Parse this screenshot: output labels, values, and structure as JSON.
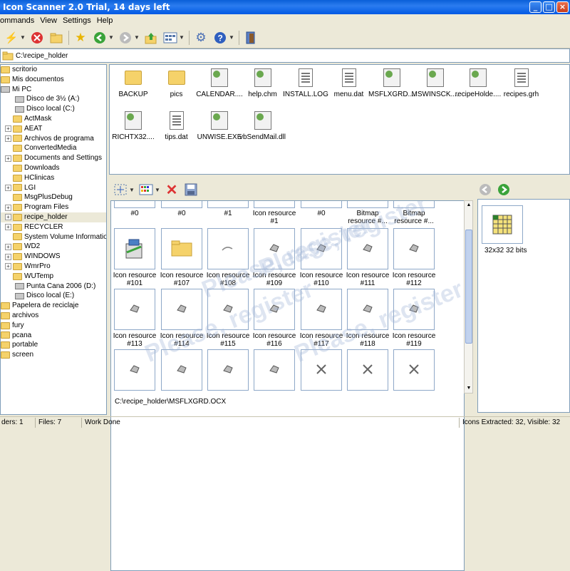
{
  "window": {
    "title": "Icon Scanner 2.0 Trial, 14 days left"
  },
  "menu": [
    "ommands",
    "View",
    "Settings",
    "Help"
  ],
  "address": {
    "path": "C:\\recipe_holder"
  },
  "tree": [
    {
      "label": "scritorio",
      "level": 0,
      "icon": "desktop-icon",
      "plus": false
    },
    {
      "label": "Mis documentos",
      "level": 0,
      "icon": "documents-icon",
      "plus": false
    },
    {
      "label": "Mi PC",
      "level": 0,
      "icon": "computer-icon",
      "plus": false
    },
    {
      "label": "Disco de 3½ (A:)",
      "level": 1,
      "icon": "floppy-icon",
      "plus": false
    },
    {
      "label": "Disco local (C:)",
      "level": 1,
      "icon": "drive-icon",
      "plus": false
    },
    {
      "label": "ActMask",
      "level": 2,
      "icon": "folder-icon",
      "plus": false
    },
    {
      "label": "AEAT",
      "level": 2,
      "icon": "folder-icon",
      "plus": true
    },
    {
      "label": "Archivos de programa",
      "level": 2,
      "icon": "folder-icon",
      "plus": true
    },
    {
      "label": "ConvertedMedia",
      "level": 2,
      "icon": "folder-icon",
      "plus": false
    },
    {
      "label": "Documents and Settings",
      "level": 2,
      "icon": "folder-icon",
      "plus": true
    },
    {
      "label": "Downloads",
      "level": 2,
      "icon": "folder-icon",
      "plus": false
    },
    {
      "label": "HClinicas",
      "level": 2,
      "icon": "folder-icon",
      "plus": false
    },
    {
      "label": "LGI",
      "level": 2,
      "icon": "folder-icon",
      "plus": true
    },
    {
      "label": "MsgPlusDebug",
      "level": 2,
      "icon": "folder-icon",
      "plus": false
    },
    {
      "label": "Program Files",
      "level": 2,
      "icon": "folder-icon",
      "plus": true
    },
    {
      "label": "recipe_holder",
      "level": 2,
      "icon": "folder-icon",
      "plus": true,
      "selected": true
    },
    {
      "label": "RECYCLER",
      "level": 2,
      "icon": "folder-icon",
      "plus": true
    },
    {
      "label": "System Volume Information",
      "level": 2,
      "icon": "folder-icon",
      "plus": false
    },
    {
      "label": "WD2",
      "level": 2,
      "icon": "folder-icon",
      "plus": true
    },
    {
      "label": "WINDOWS",
      "level": 2,
      "icon": "folder-icon",
      "plus": true
    },
    {
      "label": "WmrPro",
      "level": 2,
      "icon": "folder-icon",
      "plus": true
    },
    {
      "label": "WUTemp",
      "level": 2,
      "icon": "folder-icon",
      "plus": false
    },
    {
      "label": "Punta Cana 2006 (D:)",
      "level": 1,
      "icon": "cd-icon",
      "plus": false
    },
    {
      "label": "Disco local (E:)",
      "level": 1,
      "icon": "drive-icon",
      "plus": false
    },
    {
      "label": "Papelera de reciclaje",
      "level": 0,
      "icon": "recycle-bin-icon",
      "plus": false
    },
    {
      "label": "archivos",
      "level": 0,
      "icon": "folder-icon",
      "plus": false
    },
    {
      "label": "fury",
      "level": 0,
      "icon": "folder-icon",
      "plus": false
    },
    {
      "label": "pcana",
      "level": 0,
      "icon": "folder-icon",
      "plus": false
    },
    {
      "label": "portable",
      "level": 0,
      "icon": "folder-icon",
      "plus": false
    },
    {
      "label": "screen",
      "level": 0,
      "icon": "folder-icon",
      "plus": false
    }
  ],
  "files": [
    {
      "label": "BACKUP",
      "icon": "folder-icon"
    },
    {
      "label": "pics",
      "icon": "folder-icon"
    },
    {
      "label": "CALENDAR....",
      "icon": "component-icon"
    },
    {
      "label": "help.chm",
      "icon": "help-file-icon"
    },
    {
      "label": "INSTALL.LOG",
      "icon": "text-file-icon"
    },
    {
      "label": "menu.dat",
      "icon": "data-file-icon"
    },
    {
      "label": "MSFLXGRD....",
      "icon": "component-icon"
    },
    {
      "label": "MSWINSCK....",
      "icon": "component-icon"
    },
    {
      "label": "recipeHolde....",
      "icon": "app-icon"
    },
    {
      "label": "recipes.grh",
      "icon": "data-file-icon"
    },
    {
      "label": "RICHTX32....",
      "icon": "component-icon"
    },
    {
      "label": "tips.dat",
      "icon": "data-file-icon"
    },
    {
      "label": "UNWISE.EXE",
      "icon": "installer-icon"
    },
    {
      "label": "vbSendMail.dll",
      "icon": "component-icon"
    }
  ],
  "resources": {
    "top_row": [
      "#0",
      "#0",
      "#1",
      "Icon resource #1",
      "#0",
      "Bitmap resource #...",
      "Bitmap resource #..."
    ],
    "rows": [
      [
        "Icon resource #101",
        "Icon resource #107",
        "Icon resource #108",
        "Icon resource #109",
        "Icon resource #110",
        "Icon resource #111",
        "Icon resource #112"
      ],
      [
        "Icon resource #113",
        "Icon resource #114",
        "Icon resource #115",
        "Icon resource #116",
        "Icon resource #117",
        "Icon resource #118",
        "Icon resource #119"
      ]
    ],
    "watermark": "Please, register",
    "file_path": "C:\\recipe_holder\\MSFLXGRD.OCX"
  },
  "preview": {
    "label": "32x32 32 bits"
  },
  "status": {
    "folders": "ders: 1",
    "files": "Files: 7",
    "state": "Work Done",
    "icons": "Icons Extracted: 32, Visible: 32"
  },
  "colors": {
    "titlebar": "#0058E4",
    "chrome": "#ECE9D8",
    "folder": "#F5D26A"
  }
}
